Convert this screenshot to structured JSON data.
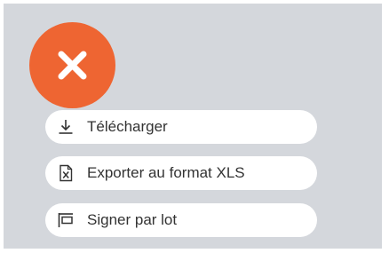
{
  "colors": {
    "panel_background": "#d4d7dc",
    "fab_background": "#ee6532",
    "fab_icon": "#ffffff",
    "menu_item_background": "#ffffff",
    "menu_text": "#333333"
  },
  "fab": {
    "icon": "close-icon"
  },
  "menu": {
    "items": [
      {
        "label": "Télécharger",
        "icon": "download-icon"
      },
      {
        "label": "Exporter au format XLS",
        "icon": "xls-file-icon"
      },
      {
        "label": "Signer par lot",
        "icon": "batch-sign-icon"
      }
    ]
  }
}
